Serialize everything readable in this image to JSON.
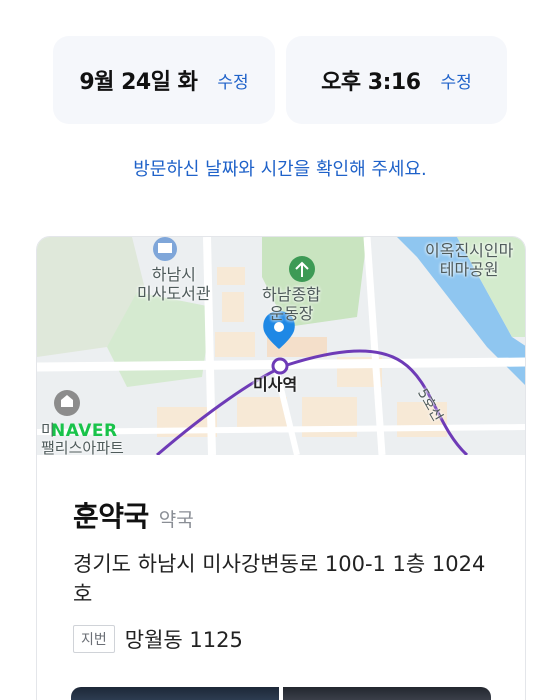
{
  "visit": {
    "date": "9월 24일 화",
    "date_edit": "수정",
    "time": "오후 3:16",
    "time_edit": "수정",
    "notice": "방문하신 날짜와 시간을 확인해 주세요."
  },
  "map": {
    "labels": {
      "library": "하남시\n미사도서관",
      "sports": "하남종합\n운동장",
      "station": "미사역",
      "park": "이옥진시인마\n테마공원",
      "line": "5호선",
      "apt": "미\n팰리스아파트"
    },
    "logo": "NAVER",
    "colors": {
      "subway_line": "#6e3bb7",
      "water": "#8fc6f0",
      "green": "#c9e4c0",
      "pin": "#1e88e5"
    }
  },
  "place": {
    "name": "훈약국",
    "category": "약국",
    "address": "경기도 하남시 미사강변동로 100-1 1층 1024호",
    "jibun_label": "지번",
    "jibun": "망월동 1125"
  }
}
